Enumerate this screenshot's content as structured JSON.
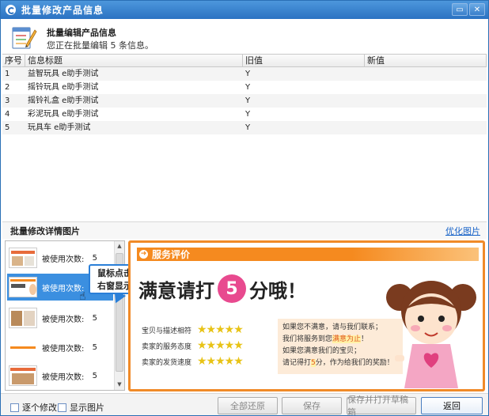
{
  "window": {
    "title": "批量修改产品信息",
    "controls": [
      "▭",
      "✕"
    ]
  },
  "header": {
    "title": "批量编辑产品信息",
    "subtitle": "您正在批量编辑 5 条信息。"
  },
  "grid": {
    "columns": [
      "序号",
      "信息标题",
      "旧值",
      "新值"
    ],
    "rows": [
      {
        "no": "1",
        "title": "益智玩具 e助手测试",
        "old": "Y",
        "new": ""
      },
      {
        "no": "2",
        "title": "摇铃玩具 e助手测试",
        "old": "Y",
        "new": ""
      },
      {
        "no": "3",
        "title": "摇铃礼盒 e助手测试",
        "old": "Y",
        "new": ""
      },
      {
        "no": "4",
        "title": "彩泥玩具 e助手测试",
        "old": "Y",
        "new": ""
      },
      {
        "no": "5",
        "title": "玩具车 e助手测试",
        "old": "Y",
        "new": ""
      }
    ]
  },
  "detail": {
    "section_title": "批量修改详情图片",
    "optimize_link": "优化图片",
    "thumbnails": [
      {
        "label": "被使用次数:",
        "count": "5",
        "selected": false
      },
      {
        "label": "被使用次数:",
        "count": "",
        "selected": true
      },
      {
        "label": "被使用次数:",
        "count": "5",
        "selected": false
      },
      {
        "label": "被使用次数:",
        "count": "5",
        "selected": false
      },
      {
        "label": "被使用次数:",
        "count": "5",
        "selected": false
      }
    ],
    "tooltip_line1": "鼠标点击",
    "tooltip_line2": "右窗显示"
  },
  "preview": {
    "bar_title": "服务评价",
    "headline_pre": "满意请打",
    "headline_num": "5",
    "headline_post": "分哦！",
    "ratings": [
      {
        "label": "宝贝与描述相符",
        "stars": "★★★★★"
      },
      {
        "label": "卖家的服务态度",
        "stars": "★★★★★"
      },
      {
        "label": "卖家的发货速度",
        "stars": "★★★★★"
      }
    ],
    "note_lines": [
      "如果您不满意，请与我们联系；",
      "我们将服务到您",
      "满意为止",
      "！",
      "如果您满意我们的宝贝；",
      "请记得打",
      "5",
      "分，作为给我们的奖励！"
    ]
  },
  "footer": {
    "check_individual": "逐个修改",
    "check_show_images": "显示图片",
    "btn_restore": "全部还原",
    "btn_save": "保存",
    "btn_save_open": "保存并打开草稿箱",
    "btn_back": "返回"
  },
  "colors": {
    "titlebar": "#2b72c2",
    "accent_orange": "#f58a1f",
    "selection": "#3b8fe0"
  }
}
